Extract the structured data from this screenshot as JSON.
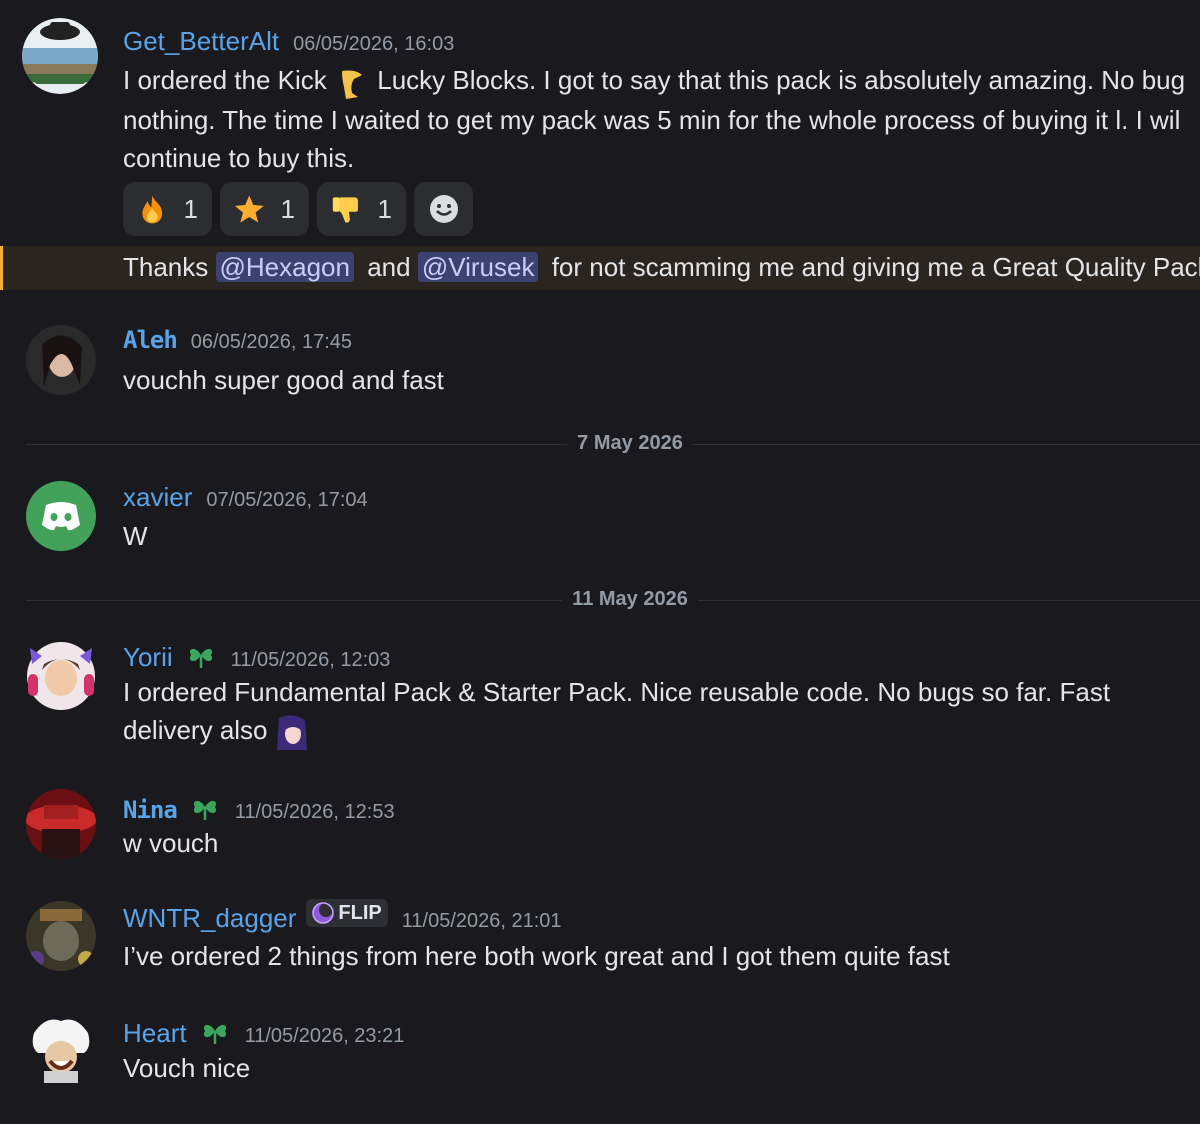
{
  "messages": [
    {
      "username": "Get_BetterAlt",
      "timestamp": "06/05/2026, 16:03",
      "lines": [
        "I ordered the Kick",
        "Lucky Blocks. I got to say that this pack is absolutely amazing. No bug",
        "nothing. The time I waited to get my pack was 5 min for the whole process of buying it l. I wil",
        "continue to buy this."
      ],
      "reactions": [
        {
          "emoji": "fire-icon",
          "count": "1"
        },
        {
          "emoji": "star-icon",
          "count": "1"
        },
        {
          "emoji": "thumbs-down-icon",
          "count": "1"
        }
      ],
      "followup": {
        "prefix": "Thanks",
        "mention1": "@Hexagon",
        "middle": "and",
        "mention2": "@Virusek",
        "suffix": "for not scamming me and giving me a Great Quality Pack"
      }
    },
    {
      "username": "Aleh",
      "timestamp": "06/05/2026, 17:45",
      "text": "vouchh super good and fast"
    },
    {
      "username": "xavier",
      "timestamp": "07/05/2026, 17:04",
      "text": "W"
    },
    {
      "username": "Yorii",
      "timestamp": "11/05/2026, 12:03",
      "lines": [
        "I ordered Fundamental Pack & Starter Pack. Nice reusable code. No bugs so far. Fast",
        "delivery also"
      ]
    },
    {
      "username": "Nina",
      "timestamp": "11/05/2026, 12:53",
      "text": "w vouch"
    },
    {
      "username": "WNTR_dagger",
      "tag": "FLIP",
      "timestamp": "11/05/2026, 21:01",
      "text": "I’ve ordered 2 things from here both work great and I got them quite fast"
    },
    {
      "username": "Heart",
      "timestamp": "11/05/2026, 23:21",
      "text": "Vouch nice"
    }
  ],
  "dividers": [
    "7 May 2026",
    "11 May 2026"
  ],
  "colors": {
    "background": "#1a1a1e",
    "username": "#5ba3e8",
    "timestamp": "#949ba4",
    "mention_bg": "#3c4270",
    "highlight_bar": "#f0b232",
    "badge_green": "#3ba55d"
  }
}
